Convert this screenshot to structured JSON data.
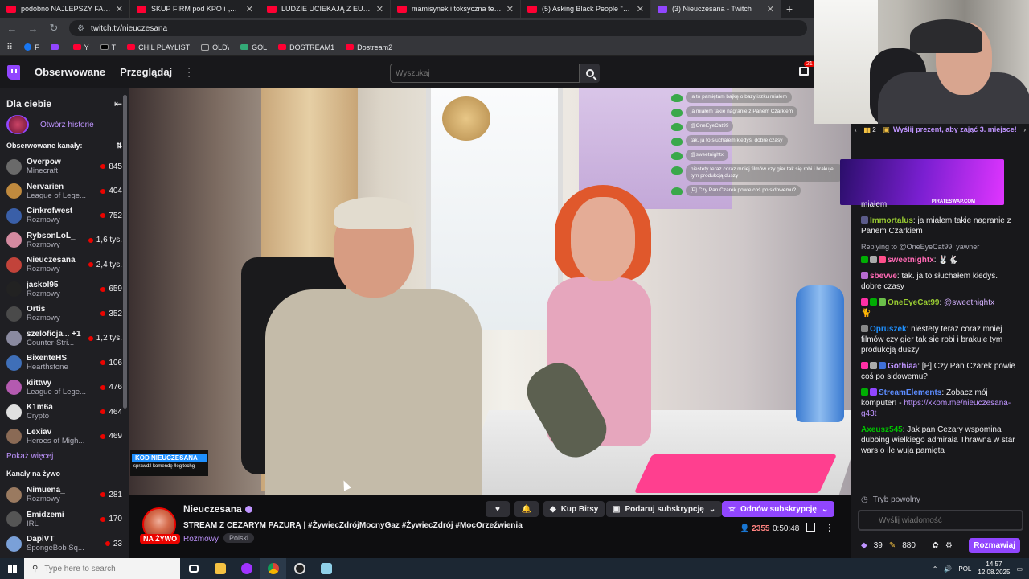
{
  "browser": {
    "tabs": [
      {
        "title": "podobno NAJLEPSZY FAST FOO",
        "type": "yt"
      },
      {
        "title": "SKUP FIRM pod KPO i „100% W",
        "type": "yt"
      },
      {
        "title": "LUDZIE UCIEKAJĄ Z EUROPEJSK",
        "type": "yt"
      },
      {
        "title": "mamisynek i toksyczna teściow",
        "type": "yt"
      },
      {
        "title": "(5) Asking Black People \"Where",
        "type": "yt"
      },
      {
        "title": "(3) Nieuczesana - Twitch",
        "type": "tw"
      }
    ],
    "url": "twitch.tv/nieuczesana",
    "bookmarks": [
      {
        "label": "F",
        "type": "fb"
      },
      {
        "label": "",
        "type": "tw"
      },
      {
        "label": "Y",
        "type": "yt"
      },
      {
        "label": "T",
        "type": "x"
      },
      {
        "label": "CHIL PLAYLIST",
        "type": "yt"
      },
      {
        "label": "OLD\\",
        "type": "fold"
      },
      {
        "label": "GOL",
        "type": "gol"
      },
      {
        "label": "DOSTREAM1",
        "type": "yt"
      },
      {
        "label": "Dostream2",
        "type": "yt"
      }
    ]
  },
  "header": {
    "following": "Obserwowane",
    "browse": "Przeglądaj",
    "more": "⋮",
    "search_placeholder": "Wyszukaj",
    "inbox_badge": "21"
  },
  "sidebar": {
    "for_you": "Dla ciebie",
    "collapse": "⇤",
    "open_stories": "Otwórz historie",
    "followed_title": "Obserwowane kanały:",
    "sort": "⇅",
    "followed": [
      {
        "name": "Overpow",
        "category": "Minecraft",
        "viewers": "845",
        "color": "#6a6a6a"
      },
      {
        "name": "Nervarien",
        "category": "League of Lege...",
        "viewers": "404",
        "color": "#c08a3e"
      },
      {
        "name": "Cinkrofwest",
        "category": "Rozmowy",
        "viewers": "752",
        "color": "#3a5fa8"
      },
      {
        "name": "RybsonLoL_",
        "category": "Rozmowy",
        "viewers": "1,6 tys.",
        "color": "#d48aa0"
      },
      {
        "name": "Nieuczesana",
        "category": "Rozmowy",
        "viewers": "2,4 tys.",
        "color": "#c2433a"
      },
      {
        "name": "jaskol95",
        "category": "Rozmowy",
        "viewers": "659",
        "color": "#222"
      },
      {
        "name": "Ortis",
        "category": "Rozmowy",
        "viewers": "352",
        "color": "#4a4a4a"
      },
      {
        "name": "szeloficja... +1",
        "category": "Counter-Stri...",
        "viewers": "1,2 tys.",
        "color": "#8a8aa0"
      },
      {
        "name": "BixenteHS",
        "category": "Hearthstone",
        "viewers": "106",
        "color": "#3f6fb8"
      },
      {
        "name": "kiittwy",
        "category": "League of Lege...",
        "viewers": "476",
        "color": "#b45ab0"
      },
      {
        "name": "K1m6a",
        "category": "Crypto",
        "viewers": "464",
        "color": "#e0e0e0"
      },
      {
        "name": "Lexiav",
        "category": "Heroes of Migh...",
        "viewers": "469",
        "color": "#8a6a55"
      }
    ],
    "show_more": "Pokaż więcej",
    "live_title": "Kanały na żywo",
    "live": [
      {
        "name": "Nimuena_",
        "category": "Rozmowy",
        "viewers": "281",
        "color": "#9a7a60"
      },
      {
        "name": "Emidzemi",
        "category": "IRL",
        "viewers": "170",
        "color": "#555"
      },
      {
        "name": "DapiVT",
        "category": "SpongeBob Sq...",
        "viewers": "23",
        "color": "#7aa0d8"
      }
    ]
  },
  "video": {
    "promo_title": "KOD NIEUCZESANA",
    "promo_sub": "sprawdź komendę !logitechg",
    "overlay_chat": [
      "ja to pamiętam bajkę o bazyliszku miałem",
      "ja miałem takie nagranie z Panem Czarkiem",
      "@OneEyeCat99",
      "tak, ja to słuchałem kiedyś, dobre czasy",
      "@sweetnightx",
      "niestety teraz coraz mniej filmów czy gier tak się robi i brakuje tym produkcją duszy",
      "[P] Czy Pan Czarek powie coś po sidowemu?"
    ]
  },
  "stream": {
    "channel": "Nieuczesana",
    "live_badge": "NA ŻYWO",
    "title": "STREAM Z CEZARYM PAZURĄ | #ŻywiecZdrójMocnyGaz #ŻywiecZdrój #MocOrzeźwienia",
    "category": "Rozmowy",
    "tag": "Polski",
    "bits": "Kup Bitsy",
    "gift": "Podaruj subskrypcję",
    "resub": "Odnów subskrypcję",
    "viewers": "2355",
    "uptime": "0:50:48"
  },
  "chat": {
    "hype_count": "2",
    "gift_prompt": "Wyślij prezent, aby zająć 3. miejsce!",
    "ad_label": "PIRATESWAP.COM",
    "messages": [
      {
        "kind": "text",
        "user": "",
        "color": "#efeff1",
        "text": "miałem"
      },
      {
        "kind": "text",
        "user": "Immortalus",
        "color": "#9acd32",
        "badges": [
          "#5b5b8a"
        ],
        "text": "ja miałem takie nagranie z Panem Czarkiem"
      },
      {
        "kind": "reply",
        "text": "Replying to @OneEyeCat99: yawner"
      },
      {
        "kind": "mention",
        "user": "sweetnightx",
        "color": "#ff69b4",
        "badges": [
          "#00ad03",
          "#aaaaaa",
          "#ff4f8b"
        ],
        "text": "🐰🐇"
      },
      {
        "kind": "text",
        "user": "sbevve",
        "color": "#ff69b4",
        "badges": [
          "#b66bd0"
        ],
        "text": "tak. ja to słuchałem kiedyś. dobre czasy"
      },
      {
        "kind": "mention2",
        "user": "OneEyeCat99",
        "color": "#9acd32",
        "badges": [
          "#ff2fa6",
          "#00ad03",
          "#6bbf4a"
        ],
        "text": "@sweetnightx",
        "extra": "🐈"
      },
      {
        "kind": "text",
        "user": "Opruszek",
        "color": "#1e90ff",
        "badges": [
          "#888888"
        ],
        "text": "niestety teraz coraz mniej filmów czy gier tak się robi i brakuje tym produkcją duszy"
      },
      {
        "kind": "text",
        "user": "Gothiaa",
        "color": "#bf94ff",
        "badges": [
          "#ff2fa6",
          "#aaaaaa",
          "#3f6fd8"
        ],
        "text": "[P] Czy Pan Czarek powie coś po sidowemu?"
      },
      {
        "kind": "link",
        "user": "StreamElements",
        "color": "#5c8cff",
        "badges": [
          "#00ad03",
          "#9146ff"
        ],
        "text": "Zobacz mój komputer! - ",
        "link": "https://xkom.me/nieuczesana-g43t"
      },
      {
        "kind": "text",
        "user": "Axeusz545",
        "color": "#00c000",
        "badges": [],
        "text": "Jak pan Cezary wspomina dubbing wielkiego admirała Thrawna w star wars o ile wuja pamięta"
      }
    ],
    "slow_mode": "Tryb powolny",
    "input_placeholder": "Wyślij wiadomość",
    "bits_count": "39",
    "points": "880",
    "chat_button": "Rozmawiaj"
  },
  "taskbar": {
    "search_placeholder": "Type here to search",
    "lang": "POL",
    "time": "14:57",
    "date": "12.08.2025"
  }
}
